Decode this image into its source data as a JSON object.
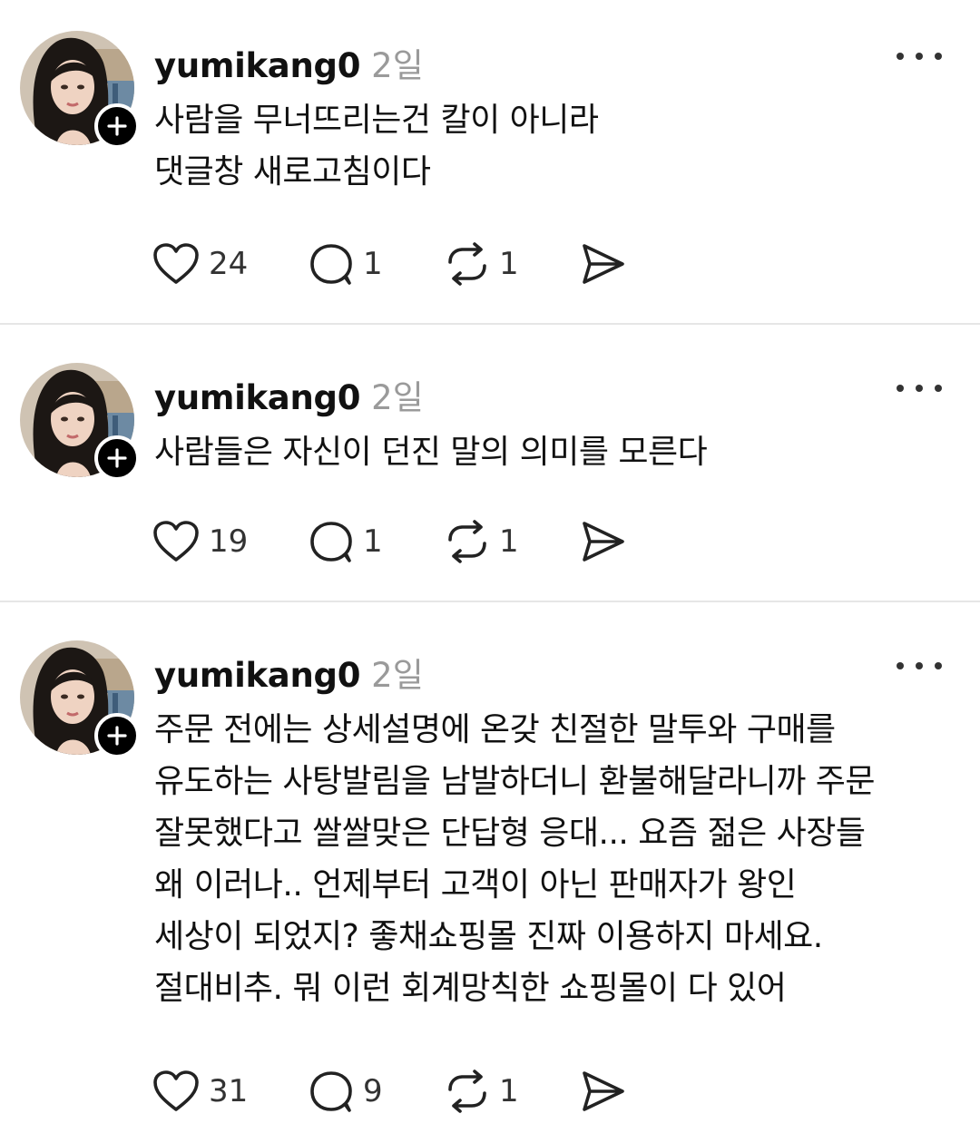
{
  "posts": [
    {
      "username": "yumikang0",
      "time": "2일",
      "lines": [
        "사람을 무너뜨리는건 칼이 아니라",
        "댓글창 새로고침이다"
      ],
      "likes": "24",
      "replies": "1",
      "reposts": "1"
    },
    {
      "username": "yumikang0",
      "time": "2일",
      "lines": [
        "사람들은 자신이 던진 말의 의미를 모른다"
      ],
      "likes": "19",
      "replies": "1",
      "reposts": "1"
    },
    {
      "username": "yumikang0",
      "time": "2일",
      "lines": [
        "주문 전에는 상세설명에 온갖 친절한 말투와 구매를",
        "유도하는 사탕발림을 남발하더니 환불해달라니까 주문",
        "잘못했다고 쌀쌀맞은 단답형 응대... 요즘 젊은 사장들",
        "왜 이러나.. 언제부터 고객이 아닌 판매자가 왕인",
        "세상이 되었지? 좋채쇼핑몰 진짜 이용하지 마세요.",
        "절대비추. 뭐 이런 회계망칙한 쇼핑몰이 다 있어"
      ],
      "likes": "31",
      "replies": "9",
      "reposts": "1"
    }
  ],
  "icons": {
    "like": "heart-icon",
    "reply": "speech-bubble-icon",
    "repost": "repost-icon",
    "share": "send-icon",
    "more": "more-dots-icon",
    "follow": "plus-icon"
  }
}
